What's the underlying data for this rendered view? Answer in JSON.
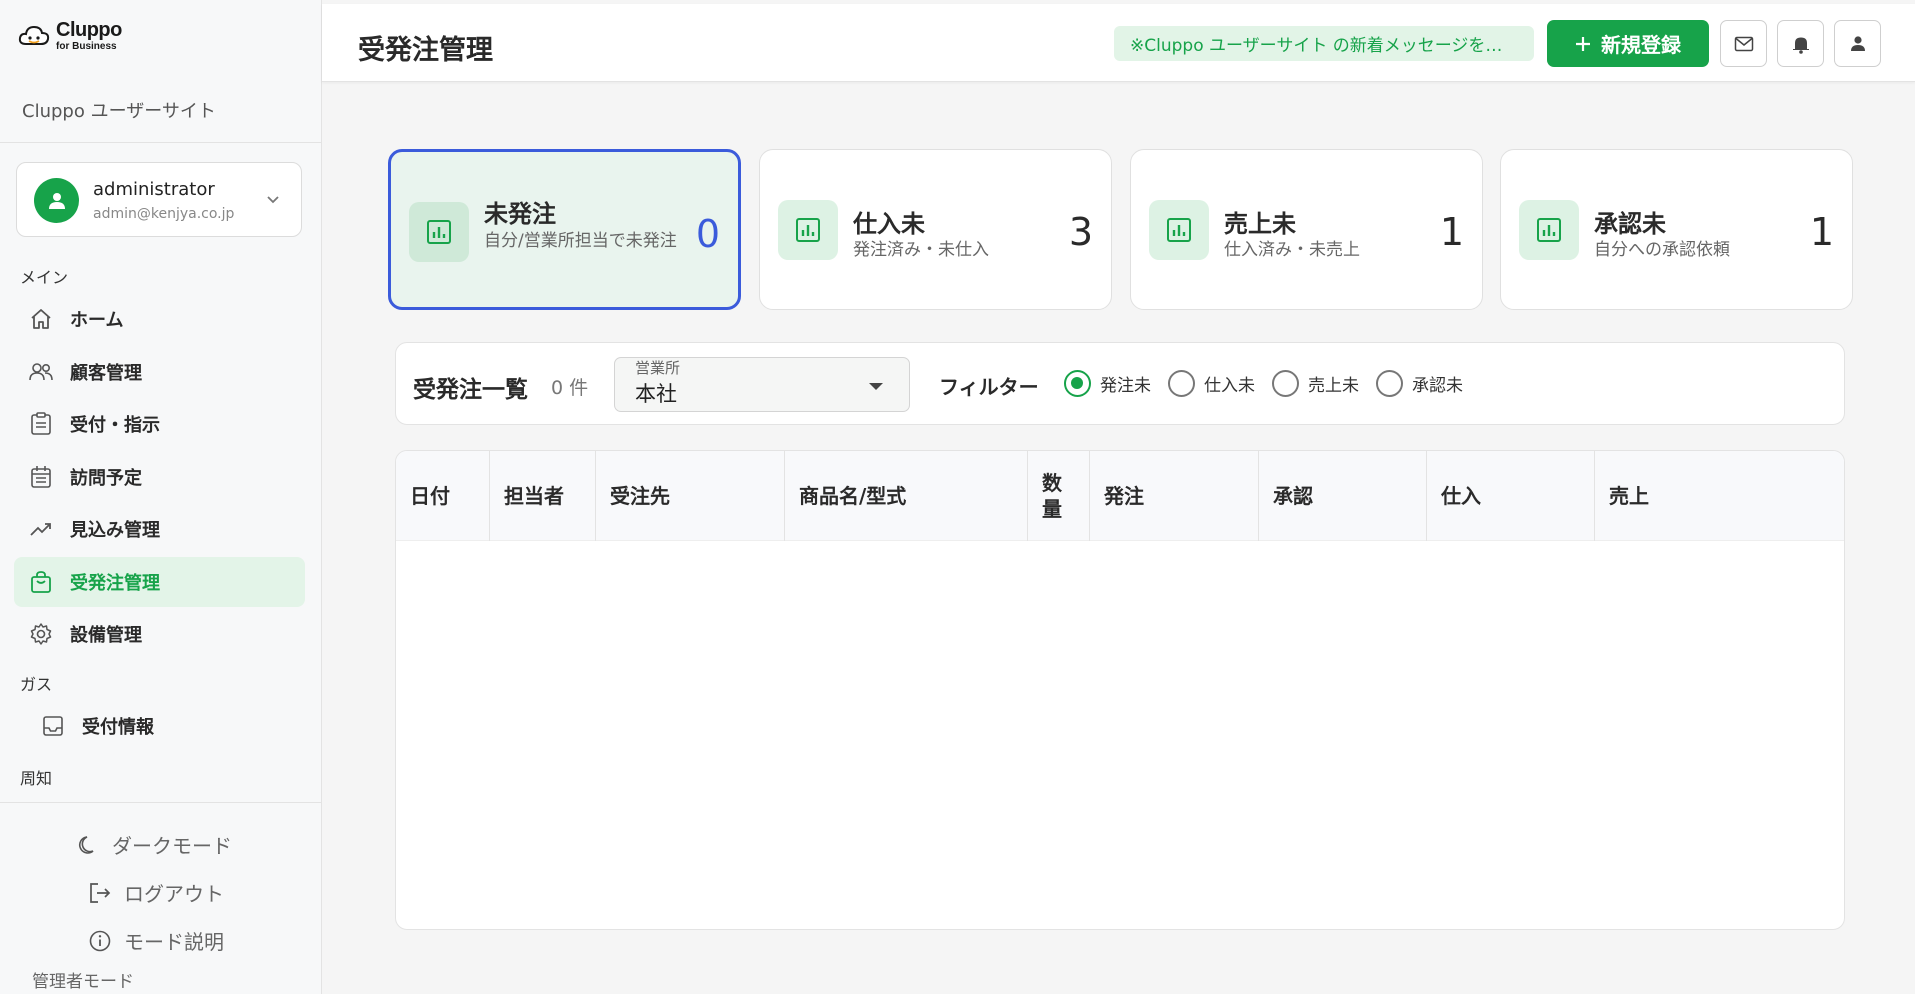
{
  "brand": {
    "name": "Cluppo",
    "sub": "for Business",
    "site_name": "Cluppo ユーザーサイト",
    "accent": "#17a34a"
  },
  "user": {
    "name": "administrator",
    "email": "admin@kenjya.co.jp"
  },
  "nav": {
    "section_main": "メイン",
    "items": [
      {
        "label": "ホーム",
        "icon": "home-icon"
      },
      {
        "label": "顧客管理",
        "icon": "users-icon"
      },
      {
        "label": "受付・指示",
        "icon": "clipboard-icon"
      },
      {
        "label": "訪問予定",
        "icon": "calendar-icon"
      },
      {
        "label": "見込み管理",
        "icon": "trend-icon"
      },
      {
        "label": "受発注管理",
        "icon": "bag-icon",
        "active": true
      },
      {
        "label": "設備管理",
        "icon": "gear-icon"
      }
    ],
    "section_gas": "ガス",
    "gas_items": [
      {
        "label": "受付情報",
        "icon": "inbox-icon"
      }
    ],
    "section_notice": "周知"
  },
  "bottom": {
    "dark_mode": "ダークモード",
    "logout": "ログアウト",
    "mode_help": "モード説明",
    "mode_label": "管理者モード"
  },
  "header": {
    "title": "受発注管理",
    "notice": "※Cluppo ユーザーサイト の新着メッセージを…",
    "new_button": "新規登録"
  },
  "cards": [
    {
      "title": "未発注",
      "sub": "自分/営業所担当で未発注",
      "count": "0",
      "active": true
    },
    {
      "title": "仕入未",
      "sub": "発注済み・未仕入",
      "count": "3"
    },
    {
      "title": "売上未",
      "sub": "仕入済み・未売上",
      "count": "1"
    },
    {
      "title": "承認未",
      "sub": "自分への承認依頼",
      "count": "1"
    }
  ],
  "list": {
    "title": "受発注一覧",
    "count": "0 件",
    "office_label": "営業所",
    "office_value": "本社",
    "filter_label": "フィルター",
    "filters": [
      {
        "label": "発注未",
        "selected": true
      },
      {
        "label": "仕入未"
      },
      {
        "label": "売上未"
      },
      {
        "label": "承認未"
      }
    ]
  },
  "table": {
    "columns": [
      "日付",
      "担当者",
      "受注先",
      "商品名/型式",
      "数量",
      "発注",
      "承認",
      "仕入",
      "売上"
    ],
    "rows": []
  }
}
